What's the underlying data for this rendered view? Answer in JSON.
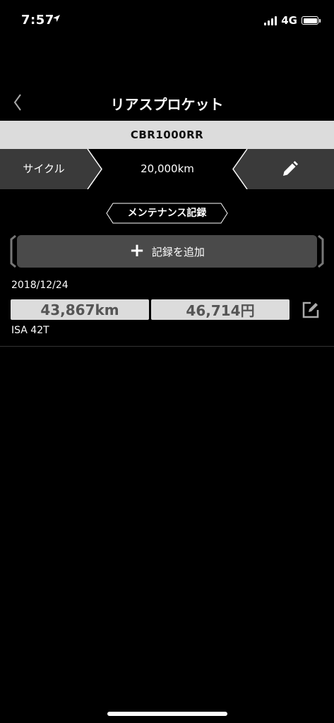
{
  "status": {
    "time": "7:57",
    "network": "4G"
  },
  "nav": {
    "title": "リアスプロケット"
  },
  "model": {
    "name": "CBR1000RR"
  },
  "cycle": {
    "label": "サイクル",
    "value": "20,000km"
  },
  "section": {
    "tag": "メンテナンス記録"
  },
  "add_button": {
    "label": "記録を追加"
  },
  "records": [
    {
      "date": "2018/12/24",
      "mileage": "43,867km",
      "cost": "46,714円",
      "note": "ISA 42T"
    }
  ],
  "colors": {
    "background": "#000000",
    "panel": "#3a3a3a",
    "light": "#dcdcdc",
    "button": "#4a4a4a"
  }
}
